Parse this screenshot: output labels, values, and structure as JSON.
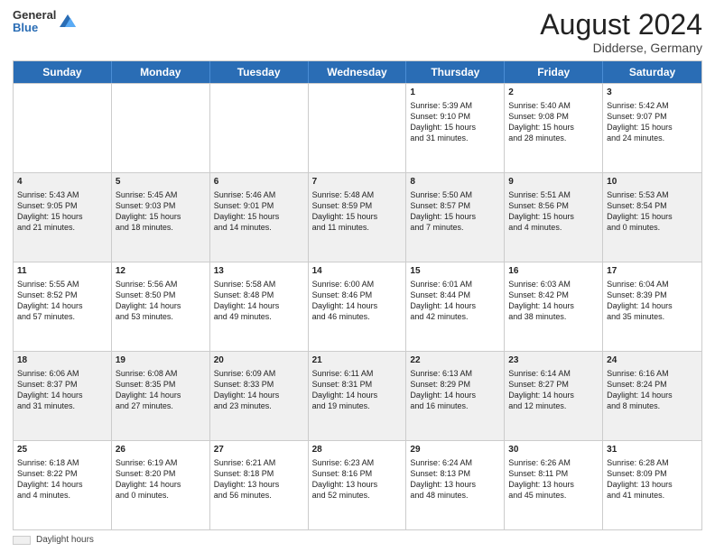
{
  "header": {
    "logo_general": "General",
    "logo_blue": "Blue",
    "month_year": "August 2024",
    "location": "Didderse, Germany"
  },
  "days_of_week": [
    "Sunday",
    "Monday",
    "Tuesday",
    "Wednesday",
    "Thursday",
    "Friday",
    "Saturday"
  ],
  "footer_label": "Daylight hours",
  "weeks": [
    [
      {
        "day": "",
        "text": ""
      },
      {
        "day": "",
        "text": ""
      },
      {
        "day": "",
        "text": ""
      },
      {
        "day": "",
        "text": ""
      },
      {
        "day": "1",
        "text": "Sunrise: 5:39 AM\nSunset: 9:10 PM\nDaylight: 15 hours\nand 31 minutes."
      },
      {
        "day": "2",
        "text": "Sunrise: 5:40 AM\nSunset: 9:08 PM\nDaylight: 15 hours\nand 28 minutes."
      },
      {
        "day": "3",
        "text": "Sunrise: 5:42 AM\nSunset: 9:07 PM\nDaylight: 15 hours\nand 24 minutes."
      }
    ],
    [
      {
        "day": "4",
        "text": "Sunrise: 5:43 AM\nSunset: 9:05 PM\nDaylight: 15 hours\nand 21 minutes."
      },
      {
        "day": "5",
        "text": "Sunrise: 5:45 AM\nSunset: 9:03 PM\nDaylight: 15 hours\nand 18 minutes."
      },
      {
        "day": "6",
        "text": "Sunrise: 5:46 AM\nSunset: 9:01 PM\nDaylight: 15 hours\nand 14 minutes."
      },
      {
        "day": "7",
        "text": "Sunrise: 5:48 AM\nSunset: 8:59 PM\nDaylight: 15 hours\nand 11 minutes."
      },
      {
        "day": "8",
        "text": "Sunrise: 5:50 AM\nSunset: 8:57 PM\nDaylight: 15 hours\nand 7 minutes."
      },
      {
        "day": "9",
        "text": "Sunrise: 5:51 AM\nSunset: 8:56 PM\nDaylight: 15 hours\nand 4 minutes."
      },
      {
        "day": "10",
        "text": "Sunrise: 5:53 AM\nSunset: 8:54 PM\nDaylight: 15 hours\nand 0 minutes."
      }
    ],
    [
      {
        "day": "11",
        "text": "Sunrise: 5:55 AM\nSunset: 8:52 PM\nDaylight: 14 hours\nand 57 minutes."
      },
      {
        "day": "12",
        "text": "Sunrise: 5:56 AM\nSunset: 8:50 PM\nDaylight: 14 hours\nand 53 minutes."
      },
      {
        "day": "13",
        "text": "Sunrise: 5:58 AM\nSunset: 8:48 PM\nDaylight: 14 hours\nand 49 minutes."
      },
      {
        "day": "14",
        "text": "Sunrise: 6:00 AM\nSunset: 8:46 PM\nDaylight: 14 hours\nand 46 minutes."
      },
      {
        "day": "15",
        "text": "Sunrise: 6:01 AM\nSunset: 8:44 PM\nDaylight: 14 hours\nand 42 minutes."
      },
      {
        "day": "16",
        "text": "Sunrise: 6:03 AM\nSunset: 8:42 PM\nDaylight: 14 hours\nand 38 minutes."
      },
      {
        "day": "17",
        "text": "Sunrise: 6:04 AM\nSunset: 8:39 PM\nDaylight: 14 hours\nand 35 minutes."
      }
    ],
    [
      {
        "day": "18",
        "text": "Sunrise: 6:06 AM\nSunset: 8:37 PM\nDaylight: 14 hours\nand 31 minutes."
      },
      {
        "day": "19",
        "text": "Sunrise: 6:08 AM\nSunset: 8:35 PM\nDaylight: 14 hours\nand 27 minutes."
      },
      {
        "day": "20",
        "text": "Sunrise: 6:09 AM\nSunset: 8:33 PM\nDaylight: 14 hours\nand 23 minutes."
      },
      {
        "day": "21",
        "text": "Sunrise: 6:11 AM\nSunset: 8:31 PM\nDaylight: 14 hours\nand 19 minutes."
      },
      {
        "day": "22",
        "text": "Sunrise: 6:13 AM\nSunset: 8:29 PM\nDaylight: 14 hours\nand 16 minutes."
      },
      {
        "day": "23",
        "text": "Sunrise: 6:14 AM\nSunset: 8:27 PM\nDaylight: 14 hours\nand 12 minutes."
      },
      {
        "day": "24",
        "text": "Sunrise: 6:16 AM\nSunset: 8:24 PM\nDaylight: 14 hours\nand 8 minutes."
      }
    ],
    [
      {
        "day": "25",
        "text": "Sunrise: 6:18 AM\nSunset: 8:22 PM\nDaylight: 14 hours\nand 4 minutes."
      },
      {
        "day": "26",
        "text": "Sunrise: 6:19 AM\nSunset: 8:20 PM\nDaylight: 14 hours\nand 0 minutes."
      },
      {
        "day": "27",
        "text": "Sunrise: 6:21 AM\nSunset: 8:18 PM\nDaylight: 13 hours\nand 56 minutes."
      },
      {
        "day": "28",
        "text": "Sunrise: 6:23 AM\nSunset: 8:16 PM\nDaylight: 13 hours\nand 52 minutes."
      },
      {
        "day": "29",
        "text": "Sunrise: 6:24 AM\nSunset: 8:13 PM\nDaylight: 13 hours\nand 48 minutes."
      },
      {
        "day": "30",
        "text": "Sunrise: 6:26 AM\nSunset: 8:11 PM\nDaylight: 13 hours\nand 45 minutes."
      },
      {
        "day": "31",
        "text": "Sunrise: 6:28 AM\nSunset: 8:09 PM\nDaylight: 13 hours\nand 41 minutes."
      }
    ]
  ]
}
